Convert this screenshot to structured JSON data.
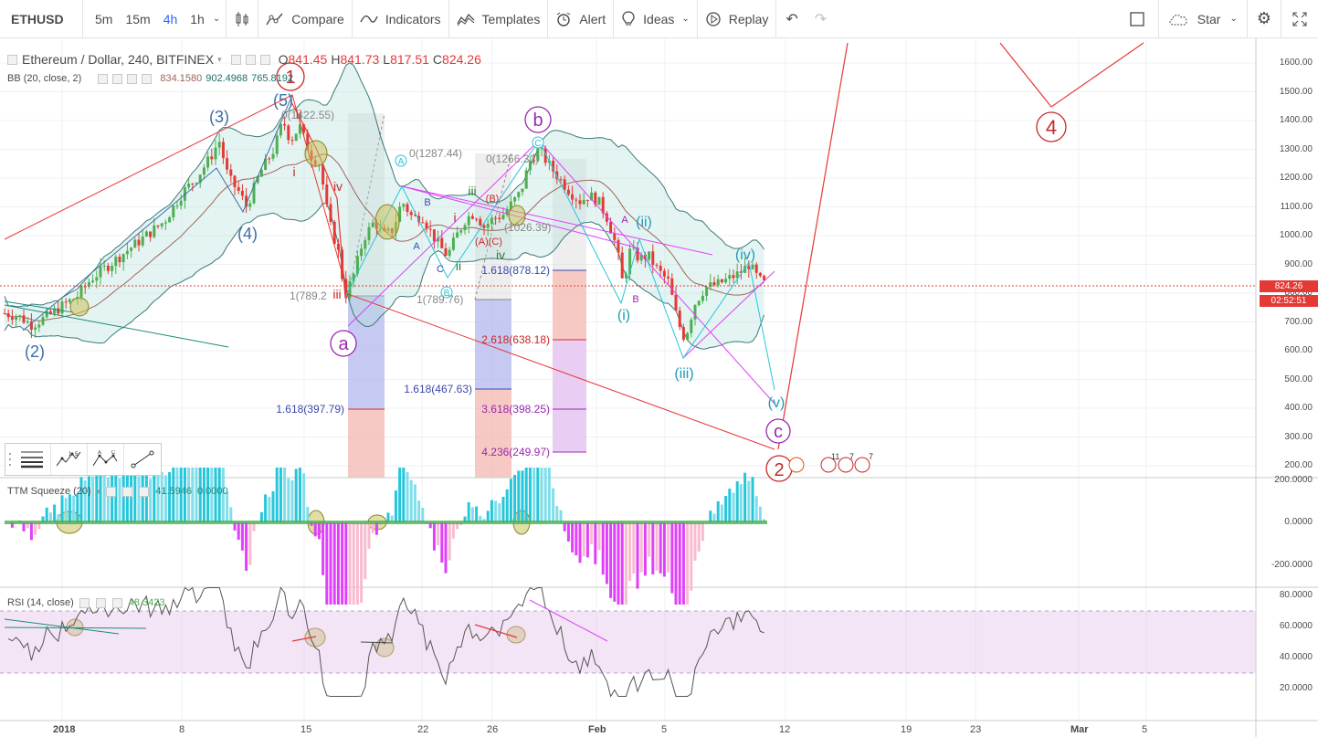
{
  "toolbar": {
    "symbol": "ETHUSD",
    "timeframes": [
      "5m",
      "15m",
      "4h",
      "1h"
    ],
    "active_timeframe_index": 2,
    "compare_label": "Compare",
    "indicators_label": "Indicators",
    "templates_label": "Templates",
    "alert_label": "Alert",
    "ideas_label": "Ideas",
    "replay_label": "Replay",
    "star_label": "Star"
  },
  "legend": {
    "title": "Ethereum / Dollar, 240, BITFINEX",
    "open_label": "O",
    "open": "841.45",
    "high_label": "H",
    "high": "841.73",
    "low_label": "L",
    "low": "817.51",
    "close_label": "C",
    "close": "824.26",
    "bb_title": "BB (20, close, 2)",
    "bb_basis": "834.1580",
    "bb_upper": "902.4968",
    "bb_lower": "765.8192"
  },
  "price_axis": [
    "1600.00",
    "1500.00",
    "1400.00",
    "1300.00",
    "1200.00",
    "1100.00",
    "1000.00",
    "900.00",
    "800.00",
    "700.00",
    "600.00",
    "500.00",
    "400.00",
    "300.00",
    "200.00"
  ],
  "price_tag": {
    "value": "824.26",
    "countdown": "02:52:51",
    "color": "#e53935"
  },
  "ttm": {
    "title": "TTM Squeeze (20)",
    "value1": "41.5946",
    "value2": "0.0000",
    "axis": [
      "200.0000",
      "0.0000",
      "-200.0000"
    ]
  },
  "rsi": {
    "title": "RSI (14, close)",
    "value": "48.3423",
    "axis": [
      "80.0000",
      "60.0000",
      "40.0000",
      "20.0000"
    ]
  },
  "time_axis": [
    "2018",
    "8",
    "15",
    "22",
    "26",
    "Feb",
    "5",
    "12",
    "19",
    "23",
    "Mar",
    "5"
  ],
  "wave_labels": {
    "w1": "1",
    "w2": "2",
    "w4": "4",
    "p2": "(2)",
    "p3": "(3)",
    "p4": "(4)",
    "p5": "(5)",
    "a": "a",
    "b": "b",
    "c": "c",
    "i_cap": "i",
    "ii": "ii",
    "iii": "iii",
    "iv": "iv",
    "iii_g": "iii",
    "iv_g": "iv",
    "ii_g": "ii",
    "wi": "(i)",
    "wii": "(ii)",
    "wiii": "(iii)",
    "wiv": "(iv)",
    "wv": "(v)",
    "A": "A",
    "B": "B",
    "C": "C",
    "Ac": "A",
    "Bc": "B",
    "Cc": "C",
    "Bp": "(B)",
    "ApCp": "(A)(C)",
    "A2": "A",
    "B2": "B",
    "A3": "A",
    "B3": "B",
    "C3": "C"
  },
  "fib_labels": {
    "f1": "0(1422.55)",
    "f2": "1(789.2",
    "f3": "1.618(397.79)",
    "f4": "0(1287.44)",
    "f5": "1(789.76)",
    "f6": "1.618(467.63)",
    "f7": "0(1266.31)",
    "f8": "(1026.39)",
    "f9": "1.618(878.12)",
    "f10": "2.618(638.18)",
    "f11": "3.618(398.25)",
    "f12": "4.236(249.97)"
  },
  "events": {
    "e1": "11",
    "e2": "7",
    "e3": "7"
  },
  "colors": {
    "up": "#4caf50",
    "down": "#e53935",
    "bb_fill": "#b2dfdb",
    "accent": "#2962ff",
    "red_wave": "#d32f2f",
    "magenta": "#ab47bc",
    "cyan": "#26c6da"
  }
}
